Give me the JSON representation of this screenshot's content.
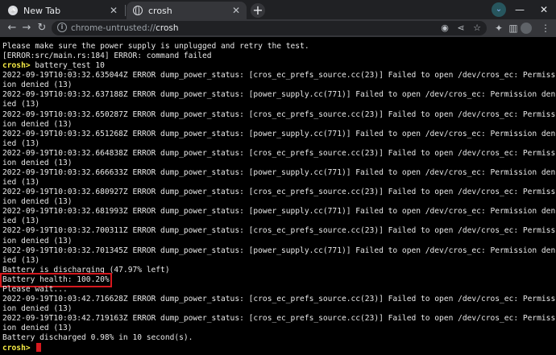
{
  "tabs": [
    {
      "title": "New Tab",
      "icon": "chrome-icon",
      "active": false
    },
    {
      "title": "crosh",
      "icon": "globe-icon",
      "active": true
    }
  ],
  "omnibox": {
    "scheme": "chrome-untrusted://",
    "host": "crosh"
  },
  "colors": {
    "prompt": "#f7ec46",
    "highlight_box": "#d6181e",
    "cursor": "#d6181e",
    "terminal_bg": "#000000",
    "terminal_fg": "#e8e8e8"
  },
  "terminal": {
    "lines": [
      {
        "text": "Please make sure the power supply is unplugged and retry the test."
      },
      {
        "text": "[ERROR:src/main.rs:184] ERROR: command failed"
      },
      {
        "prompt": "crosh>",
        "text": " battery_test 10"
      },
      {
        "text": "2022-09-19T10:03:32.635044Z ERROR dump_power_status: [cros_ec_prefs_source.cc(23)] Failed to open /dev/cros_ec: Permiss"
      },
      {
        "text": "ion denied (13)"
      },
      {
        "text": "2022-09-19T10:03:32.637188Z ERROR dump_power_status: [power_supply.cc(771)] Failed to open /dev/cros_ec: Permission den"
      },
      {
        "text": "ied (13)"
      },
      {
        "text": "2022-09-19T10:03:32.650287Z ERROR dump_power_status: [cros_ec_prefs_source.cc(23)] Failed to open /dev/cros_ec: Permiss"
      },
      {
        "text": "ion denied (13)"
      },
      {
        "text": "2022-09-19T10:03:32.651268Z ERROR dump_power_status: [power_supply.cc(771)] Failed to open /dev/cros_ec: Permission den"
      },
      {
        "text": "ied (13)"
      },
      {
        "text": "2022-09-19T10:03:32.664838Z ERROR dump_power_status: [cros_ec_prefs_source.cc(23)] Failed to open /dev/cros_ec: Permiss"
      },
      {
        "text": "ion denied (13)"
      },
      {
        "text": "2022-09-19T10:03:32.666633Z ERROR dump_power_status: [power_supply.cc(771)] Failed to open /dev/cros_ec: Permission den"
      },
      {
        "text": "ied (13)"
      },
      {
        "text": "2022-09-19T10:03:32.680927Z ERROR dump_power_status: [cros_ec_prefs_source.cc(23)] Failed to open /dev/cros_ec: Permiss"
      },
      {
        "text": "ion denied (13)"
      },
      {
        "text": "2022-09-19T10:03:32.681993Z ERROR dump_power_status: [power_supply.cc(771)] Failed to open /dev/cros_ec: Permission den"
      },
      {
        "text": "ied (13)"
      },
      {
        "text": "2022-09-19T10:03:32.700311Z ERROR dump_power_status: [cros_ec_prefs_source.cc(23)] Failed to open /dev/cros_ec: Permiss"
      },
      {
        "text": "ion denied (13)"
      },
      {
        "text": "2022-09-19T10:03:32.701345Z ERROR dump_power_status: [power_supply.cc(771)] Failed to open /dev/cros_ec: Permission den"
      },
      {
        "text": "ied (13)"
      },
      {
        "text": "Battery is discharging (47.97% left)"
      },
      {
        "text": "Battery health: 100.20%",
        "highlight": true
      },
      {
        "text": "Please wait..."
      },
      {
        "text": "2022-09-19T10:03:42.716628Z ERROR dump_power_status: [cros_ec_prefs_source.cc(23)] Failed to open /dev/cros_ec: Permiss"
      },
      {
        "text": "ion denied (13)"
      },
      {
        "text": "2022-09-19T10:03:42.719163Z ERROR dump_power_status: [cros_ec_prefs_source.cc(23)] Failed to open /dev/cros_ec: Permiss"
      },
      {
        "text": "ion denied (13)"
      },
      {
        "text": "Battery discharged 0.98% in 10 second(s)."
      },
      {
        "prompt": "crosh>",
        "text": " ",
        "cursor": true
      }
    ]
  }
}
